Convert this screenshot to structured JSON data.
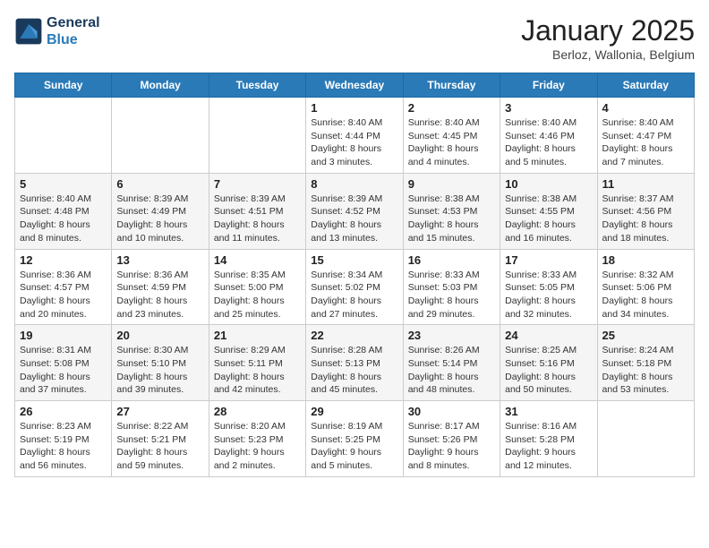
{
  "logo": {
    "line1": "General",
    "line2": "Blue"
  },
  "title": "January 2025",
  "location": "Berloz, Wallonia, Belgium",
  "weekdays": [
    "Sunday",
    "Monday",
    "Tuesday",
    "Wednesday",
    "Thursday",
    "Friday",
    "Saturday"
  ],
  "weeks": [
    [
      {
        "day": "",
        "info": ""
      },
      {
        "day": "",
        "info": ""
      },
      {
        "day": "",
        "info": ""
      },
      {
        "day": "1",
        "info": "Sunrise: 8:40 AM\nSunset: 4:44 PM\nDaylight: 8 hours\nand 3 minutes."
      },
      {
        "day": "2",
        "info": "Sunrise: 8:40 AM\nSunset: 4:45 PM\nDaylight: 8 hours\nand 4 minutes."
      },
      {
        "day": "3",
        "info": "Sunrise: 8:40 AM\nSunset: 4:46 PM\nDaylight: 8 hours\nand 5 minutes."
      },
      {
        "day": "4",
        "info": "Sunrise: 8:40 AM\nSunset: 4:47 PM\nDaylight: 8 hours\nand 7 minutes."
      }
    ],
    [
      {
        "day": "5",
        "info": "Sunrise: 8:40 AM\nSunset: 4:48 PM\nDaylight: 8 hours\nand 8 minutes."
      },
      {
        "day": "6",
        "info": "Sunrise: 8:39 AM\nSunset: 4:49 PM\nDaylight: 8 hours\nand 10 minutes."
      },
      {
        "day": "7",
        "info": "Sunrise: 8:39 AM\nSunset: 4:51 PM\nDaylight: 8 hours\nand 11 minutes."
      },
      {
        "day": "8",
        "info": "Sunrise: 8:39 AM\nSunset: 4:52 PM\nDaylight: 8 hours\nand 13 minutes."
      },
      {
        "day": "9",
        "info": "Sunrise: 8:38 AM\nSunset: 4:53 PM\nDaylight: 8 hours\nand 15 minutes."
      },
      {
        "day": "10",
        "info": "Sunrise: 8:38 AM\nSunset: 4:55 PM\nDaylight: 8 hours\nand 16 minutes."
      },
      {
        "day": "11",
        "info": "Sunrise: 8:37 AM\nSunset: 4:56 PM\nDaylight: 8 hours\nand 18 minutes."
      }
    ],
    [
      {
        "day": "12",
        "info": "Sunrise: 8:36 AM\nSunset: 4:57 PM\nDaylight: 8 hours\nand 20 minutes."
      },
      {
        "day": "13",
        "info": "Sunrise: 8:36 AM\nSunset: 4:59 PM\nDaylight: 8 hours\nand 23 minutes."
      },
      {
        "day": "14",
        "info": "Sunrise: 8:35 AM\nSunset: 5:00 PM\nDaylight: 8 hours\nand 25 minutes."
      },
      {
        "day": "15",
        "info": "Sunrise: 8:34 AM\nSunset: 5:02 PM\nDaylight: 8 hours\nand 27 minutes."
      },
      {
        "day": "16",
        "info": "Sunrise: 8:33 AM\nSunset: 5:03 PM\nDaylight: 8 hours\nand 29 minutes."
      },
      {
        "day": "17",
        "info": "Sunrise: 8:33 AM\nSunset: 5:05 PM\nDaylight: 8 hours\nand 32 minutes."
      },
      {
        "day": "18",
        "info": "Sunrise: 8:32 AM\nSunset: 5:06 PM\nDaylight: 8 hours\nand 34 minutes."
      }
    ],
    [
      {
        "day": "19",
        "info": "Sunrise: 8:31 AM\nSunset: 5:08 PM\nDaylight: 8 hours\nand 37 minutes."
      },
      {
        "day": "20",
        "info": "Sunrise: 8:30 AM\nSunset: 5:10 PM\nDaylight: 8 hours\nand 39 minutes."
      },
      {
        "day": "21",
        "info": "Sunrise: 8:29 AM\nSunset: 5:11 PM\nDaylight: 8 hours\nand 42 minutes."
      },
      {
        "day": "22",
        "info": "Sunrise: 8:28 AM\nSunset: 5:13 PM\nDaylight: 8 hours\nand 45 minutes."
      },
      {
        "day": "23",
        "info": "Sunrise: 8:26 AM\nSunset: 5:14 PM\nDaylight: 8 hours\nand 48 minutes."
      },
      {
        "day": "24",
        "info": "Sunrise: 8:25 AM\nSunset: 5:16 PM\nDaylight: 8 hours\nand 50 minutes."
      },
      {
        "day": "25",
        "info": "Sunrise: 8:24 AM\nSunset: 5:18 PM\nDaylight: 8 hours\nand 53 minutes."
      }
    ],
    [
      {
        "day": "26",
        "info": "Sunrise: 8:23 AM\nSunset: 5:19 PM\nDaylight: 8 hours\nand 56 minutes."
      },
      {
        "day": "27",
        "info": "Sunrise: 8:22 AM\nSunset: 5:21 PM\nDaylight: 8 hours\nand 59 minutes."
      },
      {
        "day": "28",
        "info": "Sunrise: 8:20 AM\nSunset: 5:23 PM\nDaylight: 9 hours\nand 2 minutes."
      },
      {
        "day": "29",
        "info": "Sunrise: 8:19 AM\nSunset: 5:25 PM\nDaylight: 9 hours\nand 5 minutes."
      },
      {
        "day": "30",
        "info": "Sunrise: 8:17 AM\nSunset: 5:26 PM\nDaylight: 9 hours\nand 8 minutes."
      },
      {
        "day": "31",
        "info": "Sunrise: 8:16 AM\nSunset: 5:28 PM\nDaylight: 9 hours\nand 12 minutes."
      },
      {
        "day": "",
        "info": ""
      }
    ]
  ]
}
